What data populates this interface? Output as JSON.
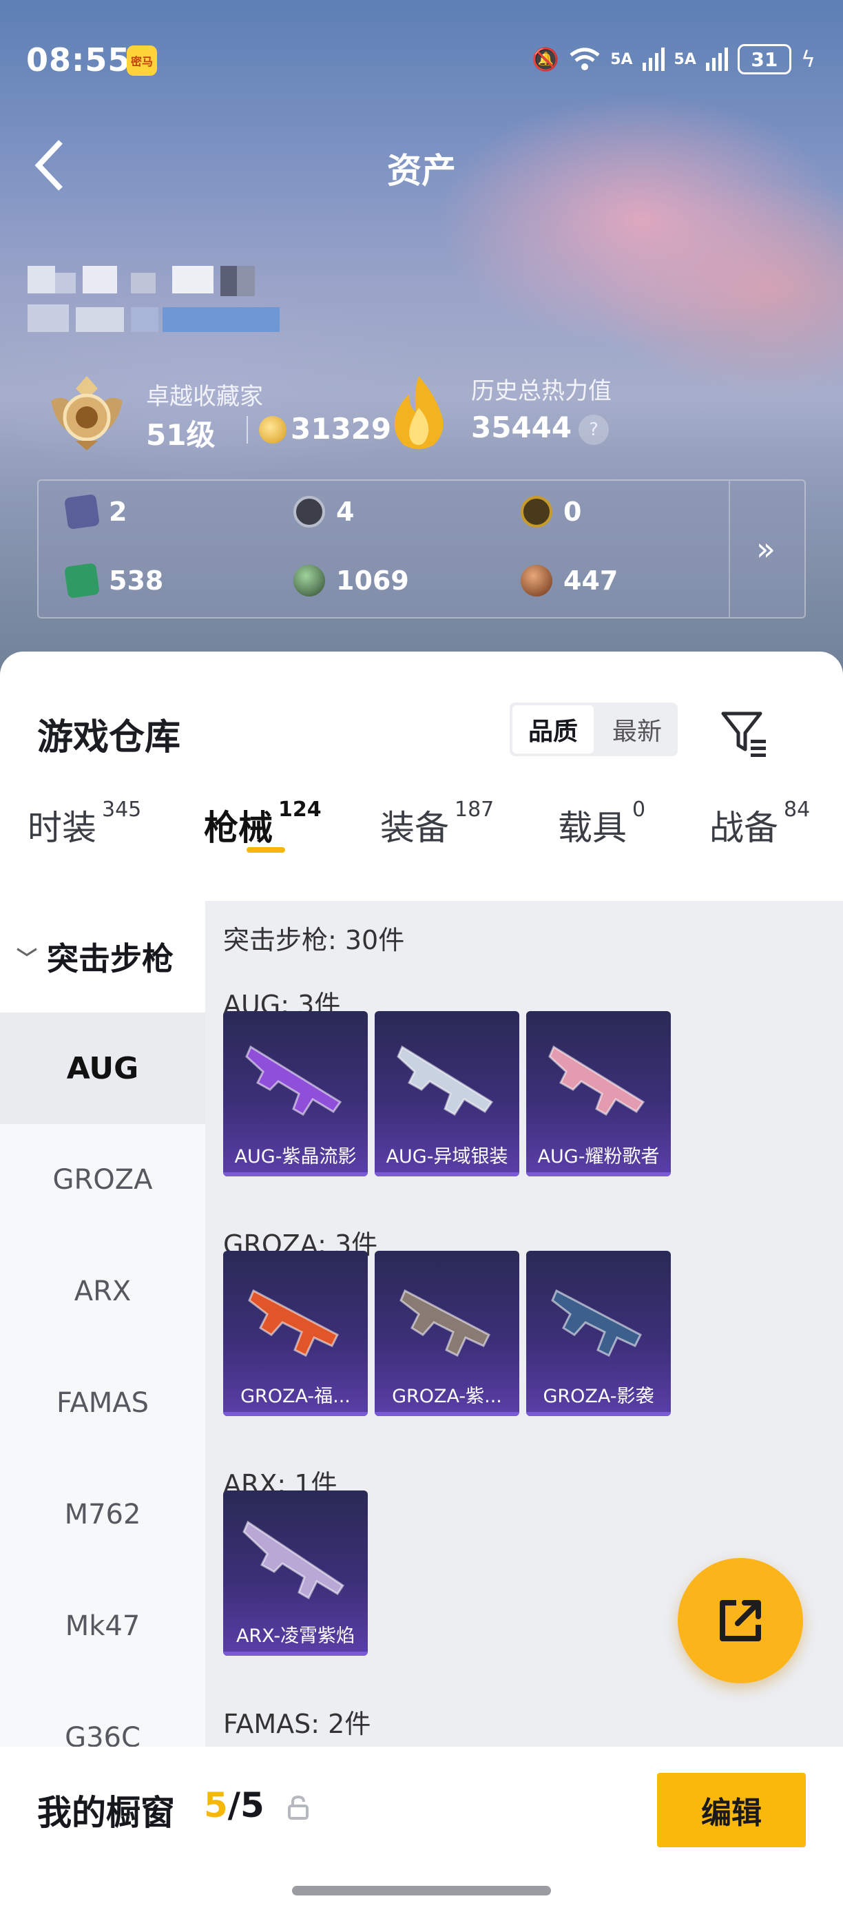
{
  "status_bar": {
    "time": "08:55",
    "app_badge": "密马",
    "signal_1": "5A",
    "signal_2": "5A",
    "battery": "31"
  },
  "header": {
    "title": "资产"
  },
  "profile": {
    "rank_title": "卓越收藏家",
    "level": "51级",
    "score": "31329",
    "heat_label": "历史总热力值",
    "heat_value": "35444",
    "help": "?"
  },
  "currencies": [
    {
      "value": "2",
      "icon": "card-icon",
      "color": "#5a5f9a"
    },
    {
      "value": "4",
      "icon": "coin-dark-icon",
      "color": "#3c3f4a"
    },
    {
      "value": "0",
      "icon": "coin-gold-icon",
      "color": "#c79a2e"
    },
    {
      "value": "538",
      "icon": "ticket-green-icon",
      "color": "#2f9a63"
    },
    {
      "value": "1069",
      "icon": "orb-green-icon",
      "color": "#4d6a4f"
    },
    {
      "value": "447",
      "icon": "orb-bronze-icon",
      "color": "#9a5a36"
    }
  ],
  "more": "»",
  "warehouse": {
    "title": "游戏仓库",
    "sort_options": [
      "品质",
      "最新"
    ],
    "active_sort": "品质"
  },
  "tabs": [
    {
      "label": "时装",
      "count": "345"
    },
    {
      "label": "枪械",
      "count": "124"
    },
    {
      "label": "装备",
      "count": "187"
    },
    {
      "label": "载具",
      "count": "0"
    },
    {
      "label": "战备",
      "count": "84"
    }
  ],
  "active_tab": "枪械",
  "sidebar": {
    "group": "突击步枪",
    "items": [
      "AUG",
      "GROZA",
      "ARX",
      "FAMAS",
      "M762",
      "Mk47",
      "G36C"
    ]
  },
  "list": {
    "head": "突击步枪: 30件",
    "groups": [
      {
        "label": "AUG: 3件",
        "cards": [
          "AUG-紫晶流影",
          "AUG-异域银装",
          "AUG-耀粉歌者"
        ]
      },
      {
        "label": "GROZA: 3件",
        "cards": [
          "GROZA-福...",
          "GROZA-紫...",
          "GROZA-影袭"
        ]
      },
      {
        "label": "ARX: 1件",
        "cards": [
          "ARX-凌霄紫焰"
        ]
      },
      {
        "label": "FAMAS: 2件",
        "cards": []
      }
    ]
  },
  "card_colors": [
    "#8f4fd8",
    "#c9d2e0",
    "#e39bb0",
    "#e0562a",
    "#8a7a74",
    "#3d5f8c",
    "#b9a7d6"
  ],
  "bottom": {
    "label": "我的橱窗",
    "current": "5",
    "total": "/5",
    "edit": "编辑"
  }
}
